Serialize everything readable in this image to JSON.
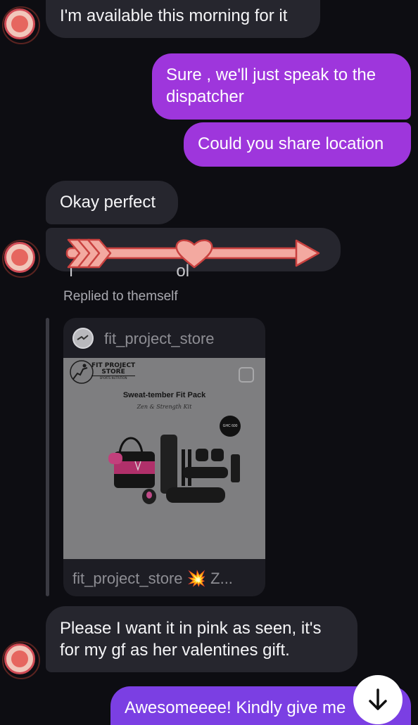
{
  "messages": [
    {
      "text": "I'm available this morning for it"
    },
    {
      "text": "Sure , we'll just speak to the dispatcher"
    },
    {
      "text": "Could you share location"
    },
    {
      "text": "Okay perfect"
    },
    {
      "text": "l                      ol"
    },
    {
      "text": "Please I want it in pink as seen, it's for my gf as her valentines gift."
    },
    {
      "text": "Awesomeeee! Kindly give me"
    }
  ],
  "reply_label": "Replied to themself",
  "shared_post": {
    "account": "fit_project_store",
    "caption": "fit_project_store 💥 Z...",
    "image": {
      "brand_line1": "FIT PROJECT",
      "brand_line2": "STORE",
      "brand_tagline": "SPORTS NUTRITION",
      "title": "Sweat-tember Fit Pack",
      "subtitle": "Zen & Strength Kit",
      "price_badge": "GHC 600"
    }
  },
  "colors": {
    "background": "#0d0d12",
    "incoming_bubble": "#26262e",
    "outgoing_bubble": "#9e36dc",
    "sticker": "#f3a9a0"
  },
  "icons": {
    "scroll_down": "arrow-down-icon",
    "sticker": "arrow-heart-sticker"
  }
}
